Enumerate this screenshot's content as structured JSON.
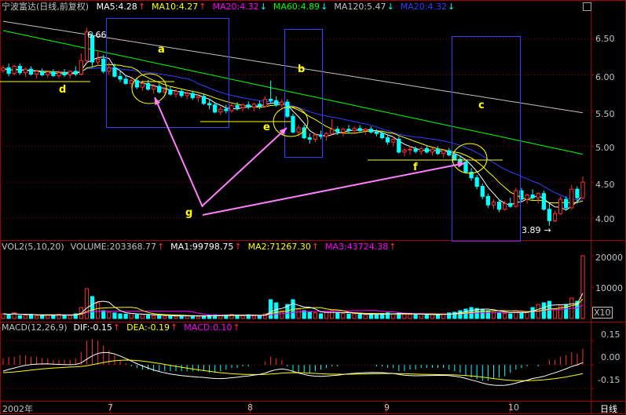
{
  "stock": {
    "title": "宁波富达(日线,前复权)",
    "ma": [
      {
        "label": "MA5:4.28",
        "arrow": "↑",
        "color": "#ffffff"
      },
      {
        "label": "MA10:4.27",
        "arrow": "↑",
        "color": "#ffff00"
      },
      {
        "label": "MA20:4.32",
        "arrow": "↓",
        "color": "#ff00ff"
      },
      {
        "label": "MA60:4.89",
        "arrow": "↓",
        "color": "#00ff00"
      },
      {
        "label": "MA120:5.47",
        "arrow": "↓",
        "color": "#c0c0c0"
      },
      {
        "label": "MA20:4.32",
        "arrow": "↓",
        "color": "#3040ff"
      }
    ]
  },
  "volume": {
    "items": [
      {
        "label": "VOL2(5,10,20)",
        "arrow": "",
        "color": "#c0c0c0"
      },
      {
        "label": "VOLUME:203368.77",
        "arrow": "↑",
        "color": "#c0c0c0"
      },
      {
        "label": "MA1:99798.75",
        "arrow": "↑",
        "color": "#ffffff"
      },
      {
        "label": "MA2:71267.30",
        "arrow": "↑",
        "color": "#ffff00"
      },
      {
        "label": "MA3:43724.38",
        "arrow": "↑",
        "color": "#ff00ff"
      }
    ],
    "multiplier": "X10"
  },
  "macd": {
    "items": [
      {
        "label": "MACD(12,26,9)",
        "arrow": "",
        "color": "#c0c0c0"
      },
      {
        "label": "DIF:-0.15",
        "arrow": "↑",
        "color": "#ffffff"
      },
      {
        "label": "DEA:-0.19",
        "arrow": "↑",
        "color": "#ffff00"
      },
      {
        "label": "MACD:0.10",
        "arrow": "↑",
        "color": "#ff00ff"
      }
    ]
  },
  "axes": {
    "price_ticks": [
      "6.50",
      "6.00",
      "5.50",
      "5.00",
      "4.50",
      "4.00"
    ],
    "volume_ticks": [
      "20000",
      "10000"
    ],
    "macd_ticks": [
      "0.15",
      "0.00",
      "-0.15"
    ],
    "x_labels": [
      "2002年",
      "7",
      "8",
      "9",
      "10"
    ],
    "period": "日线"
  },
  "annotations": {
    "labels": [
      "a",
      "b",
      "c",
      "d",
      "e",
      "f",
      "g"
    ],
    "high_label": "6.66",
    "low_label": "3.89",
    "low_arrow": "→"
  },
  "chart_data": {
    "type": "candlestick",
    "ylim": [
      3.7,
      6.85
    ],
    "price_ticks": [
      6.5,
      6.0,
      5.5,
      5.0,
      4.5,
      4.0
    ],
    "candles": [
      [
        6.06,
        6.13,
        6.03,
        6.1
      ],
      [
        6.1,
        6.16,
        5.98,
        6.02
      ],
      [
        6.02,
        6.14,
        5.99,
        6.12
      ],
      [
        6.12,
        6.16,
        6.0,
        6.03
      ],
      [
        6.03,
        6.1,
        5.97,
        6.08
      ],
      [
        6.08,
        6.12,
        5.99,
        6.01
      ],
      [
        6.01,
        6.07,
        5.95,
        6.05
      ],
      [
        6.05,
        6.09,
        5.98,
        6.0
      ],
      [
        6.0,
        6.06,
        5.96,
        6.04
      ],
      [
        6.04,
        6.08,
        5.97,
        5.99
      ],
      [
        5.99,
        6.06,
        5.95,
        6.03
      ],
      [
        6.03,
        6.08,
        5.97,
        6.0
      ],
      [
        6.0,
        6.06,
        5.95,
        6.05
      ],
      [
        6.05,
        6.12,
        5.98,
        6.01
      ],
      [
        6.01,
        6.3,
        5.99,
        6.2
      ],
      [
        6.2,
        6.66,
        6.15,
        6.6
      ],
      [
        6.55,
        6.6,
        6.1,
        6.18
      ],
      [
        6.18,
        6.34,
        6.12,
        6.22
      ],
      [
        6.22,
        6.28,
        6.02,
        6.05
      ],
      [
        6.05,
        6.18,
        6.0,
        6.1
      ],
      [
        6.1,
        6.16,
        5.96,
        5.98
      ],
      [
        5.98,
        6.05,
        5.9,
        5.94
      ],
      [
        5.94,
        6.0,
        5.86,
        5.88
      ],
      [
        5.88,
        5.96,
        5.82,
        5.92
      ],
      [
        5.92,
        5.96,
        5.8,
        5.83
      ],
      [
        5.83,
        5.92,
        5.78,
        5.88
      ],
      [
        5.88,
        5.93,
        5.78,
        5.8
      ],
      [
        5.8,
        5.87,
        5.74,
        5.84
      ],
      [
        5.84,
        5.88,
        5.74,
        5.76
      ],
      [
        5.76,
        5.82,
        5.7,
        5.79
      ],
      [
        5.79,
        5.83,
        5.71,
        5.73
      ],
      [
        5.73,
        5.8,
        5.68,
        5.77
      ],
      [
        5.77,
        5.8,
        5.68,
        5.71
      ],
      [
        5.71,
        5.76,
        5.66,
        5.74
      ],
      [
        5.74,
        5.78,
        5.65,
        5.68
      ],
      [
        5.68,
        5.72,
        5.62,
        5.7
      ],
      [
        5.7,
        5.74,
        5.58,
        5.6
      ],
      [
        5.6,
        5.66,
        5.52,
        5.58
      ],
      [
        5.58,
        5.62,
        5.46,
        5.48
      ],
      [
        5.48,
        5.56,
        5.44,
        5.52
      ],
      [
        5.52,
        5.58,
        5.46,
        5.5
      ],
      [
        5.5,
        5.6,
        5.47,
        5.57
      ],
      [
        5.57,
        5.62,
        5.5,
        5.54
      ],
      [
        5.54,
        5.6,
        5.49,
        5.58
      ],
      [
        5.58,
        5.63,
        5.52,
        5.55
      ],
      [
        5.55,
        5.61,
        5.49,
        5.59
      ],
      [
        5.59,
        5.64,
        5.52,
        5.56
      ],
      [
        5.56,
        5.7,
        5.54,
        5.66
      ],
      [
        5.66,
        5.92,
        5.6,
        5.64
      ],
      [
        5.64,
        5.7,
        5.55,
        5.58
      ],
      [
        5.58,
        5.66,
        5.52,
        5.62
      ],
      [
        5.62,
        5.66,
        5.4,
        5.42
      ],
      [
        5.42,
        5.46,
        5.18,
        5.2
      ],
      [
        5.2,
        5.3,
        5.14,
        5.26
      ],
      [
        5.26,
        5.3,
        5.1,
        5.12
      ],
      [
        5.12,
        5.18,
        5.04,
        5.1
      ],
      [
        5.1,
        5.18,
        5.06,
        5.16
      ],
      [
        5.16,
        5.22,
        5.1,
        5.14
      ],
      [
        5.14,
        5.2,
        5.08,
        5.18
      ],
      [
        5.18,
        5.38,
        5.16,
        5.24
      ],
      [
        5.24,
        5.28,
        5.16,
        5.2
      ],
      [
        5.2,
        5.26,
        5.14,
        5.24
      ],
      [
        5.24,
        5.3,
        5.18,
        5.22
      ],
      [
        5.22,
        5.28,
        5.17,
        5.25
      ],
      [
        5.25,
        5.3,
        5.2,
        5.22
      ],
      [
        5.22,
        5.26,
        5.16,
        5.24
      ],
      [
        5.24,
        5.28,
        5.18,
        5.2
      ],
      [
        5.2,
        5.24,
        5.14,
        5.18
      ],
      [
        5.18,
        5.22,
        5.1,
        5.12
      ],
      [
        5.12,
        5.16,
        5.02,
        5.06
      ],
      [
        5.06,
        5.14,
        5.0,
        5.1
      ],
      [
        5.1,
        5.14,
        4.9,
        4.92
      ],
      [
        4.92,
        4.98,
        4.86,
        4.95
      ],
      [
        4.95,
        5.0,
        4.88,
        4.96
      ],
      [
        4.96,
        5.0,
        4.9,
        4.93
      ],
      [
        4.93,
        4.99,
        4.88,
        4.97
      ],
      [
        4.97,
        5.01,
        4.9,
        4.92
      ],
      [
        4.92,
        4.98,
        4.87,
        4.96
      ],
      [
        4.96,
        5.0,
        4.88,
        4.9
      ],
      [
        4.9,
        4.96,
        4.84,
        4.94
      ],
      [
        4.94,
        4.98,
        4.86,
        4.88
      ],
      [
        4.88,
        4.92,
        4.8,
        4.82
      ],
      [
        4.82,
        4.88,
        4.74,
        4.78
      ],
      [
        4.78,
        4.82,
        4.62,
        4.64
      ],
      [
        4.64,
        4.7,
        4.52,
        4.56
      ],
      [
        4.56,
        4.6,
        4.4,
        4.44
      ],
      [
        4.44,
        4.48,
        4.26,
        4.3
      ],
      [
        4.3,
        4.34,
        4.14,
        4.18
      ],
      [
        4.18,
        4.26,
        4.12,
        4.22
      ],
      [
        4.22,
        4.26,
        4.08,
        4.12
      ],
      [
        4.12,
        4.24,
        4.1,
        4.2
      ],
      [
        4.2,
        4.28,
        4.14,
        4.16
      ],
      [
        4.16,
        4.42,
        4.14,
        4.38
      ],
      [
        4.38,
        4.42,
        4.22,
        4.26
      ],
      [
        4.26,
        4.34,
        4.2,
        4.32
      ],
      [
        4.32,
        4.4,
        4.24,
        4.28
      ],
      [
        4.28,
        4.36,
        4.2,
        4.34
      ],
      [
        4.34,
        4.38,
        4.1,
        4.12
      ],
      [
        4.12,
        4.2,
        3.89,
        3.96
      ],
      [
        3.96,
        4.1,
        3.94,
        4.06
      ],
      [
        4.06,
        4.3,
        4.04,
        4.26
      ],
      [
        4.26,
        4.3,
        4.1,
        4.14
      ],
      [
        4.14,
        4.46,
        4.12,
        4.4
      ],
      [
        4.4,
        4.44,
        4.2,
        4.28
      ],
      [
        4.28,
        4.58,
        4.26,
        4.5
      ]
    ],
    "volume_ylim": [
      0,
      21000
    ],
    "volume_ticks": [
      20000,
      10000
    ],
    "volume": [
      1500,
      1200,
      1800,
      900,
      1100,
      1300,
      800,
      1000,
      1200,
      900,
      1400,
      1100,
      1000,
      1500,
      3500,
      9500,
      7000,
      5000,
      2500,
      2000,
      1800,
      1500,
      1400,
      1600,
      1200,
      1300,
      1100,
      900,
      1000,
      800,
      900,
      700,
      1000,
      800,
      900,
      700,
      800,
      1000,
      1200,
      900,
      1100,
      1300,
      1000,
      900,
      1200,
      800,
      1000,
      1500,
      6000,
      5000,
      2500,
      4500,
      6000,
      3000,
      2500,
      2000,
      1800,
      1500,
      2000,
      2500,
      1800,
      1600,
      1400,
      1500,
      1300,
      1200,
      1400,
      1200,
      1600,
      1800,
      1500,
      1700,
      1400,
      1300,
      1200,
      1500,
      1100,
      1300,
      1200,
      1500,
      1800,
      2000,
      2500,
      3000,
      3500,
      3200,
      2800,
      2500,
      2000,
      1800,
      1600,
      1500,
      2500,
      2000,
      2200,
      3500,
      4500,
      5000,
      5500,
      3000,
      4000,
      4500,
      6500,
      5500,
      20000
    ],
    "macd_ylim": [
      -0.22,
      0.22
    ],
    "macd_ticks": [
      0.15,
      0.0,
      -0.15
    ],
    "macd": [
      0.04,
      0.05,
      0.05,
      0.06,
      0.06,
      0.05,
      0.05,
      0.04,
      0.04,
      0.03,
      0.03,
      0.03,
      0.03,
      0.04,
      0.08,
      0.15,
      0.16,
      0.15,
      0.12,
      0.09,
      0.06,
      0.03,
      0.01,
      -0.01,
      -0.02,
      -0.03,
      -0.03,
      -0.04,
      -0.04,
      -0.04,
      -0.04,
      -0.04,
      -0.04,
      -0.04,
      -0.04,
      -0.04,
      -0.04,
      -0.05,
      -0.05,
      -0.04,
      -0.03,
      -0.02,
      -0.02,
      -0.01,
      -0.01,
      0.0,
      0.0,
      0.02,
      0.05,
      0.04,
      0.03,
      -0.01,
      -0.04,
      -0.05,
      -0.05,
      -0.05,
      -0.04,
      -0.03,
      -0.02,
      -0.01,
      -0.01,
      0.0,
      0.0,
      0.0,
      0.0,
      0.0,
      0.0,
      -0.01,
      -0.01,
      -0.02,
      -0.02,
      -0.04,
      -0.04,
      -0.03,
      -0.03,
      -0.02,
      -0.02,
      -0.02,
      -0.02,
      -0.02,
      -0.03,
      -0.04,
      -0.05,
      -0.07,
      -0.08,
      -0.09,
      -0.1,
      -0.1,
      -0.09,
      -0.08,
      -0.07,
      -0.05,
      -0.03,
      -0.02,
      -0.01,
      0.0,
      -0.01,
      0.0,
      0.03,
      0.03,
      0.05,
      0.06,
      0.08,
      0.07,
      0.1
    ]
  }
}
